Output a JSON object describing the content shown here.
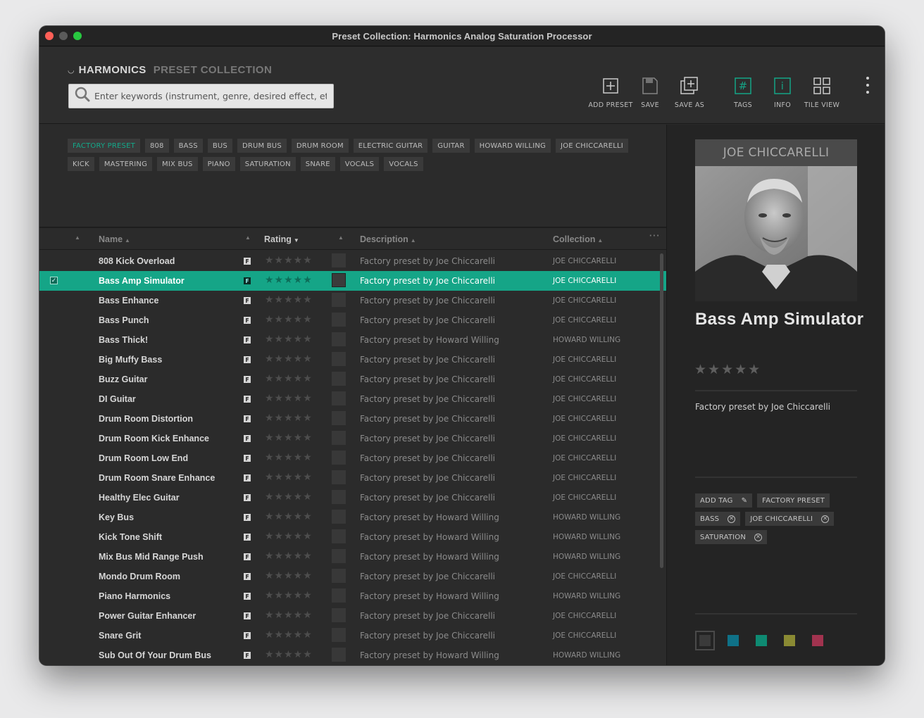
{
  "window": {
    "title": "Preset Collection: Harmonics Analog Saturation Processor"
  },
  "brand": {
    "name": "HARMONICS",
    "subtitle": "PRESET COLLECTION"
  },
  "search": {
    "placeholder": "Enter keywords (instrument, genre, desired effect, etc.)",
    "value": ""
  },
  "toolbar": {
    "add_preset": "ADD PRESET",
    "save": "SAVE",
    "save_as": "SAVE AS",
    "tags": "TAGS",
    "info": "INFO",
    "tile_view": "TILE VIEW"
  },
  "tag_filters": [
    {
      "label": "FACTORY PRESET",
      "active": true
    },
    {
      "label": "808"
    },
    {
      "label": "BASS"
    },
    {
      "label": "BUS"
    },
    {
      "label": "DRUM BUS"
    },
    {
      "label": "DRUM ROOM"
    },
    {
      "label": "ELECTRIC GUITAR"
    },
    {
      "label": "GUITAR"
    },
    {
      "label": "HOWARD WILLING"
    },
    {
      "label": "JOE CHICCARELLI"
    },
    {
      "label": "KICK"
    },
    {
      "label": "MASTERING"
    },
    {
      "label": "MIX BUS"
    },
    {
      "label": "PIANO"
    },
    {
      "label": "SATURATION"
    },
    {
      "label": "SNARE"
    },
    {
      "label": "VOCALS"
    },
    {
      "label": "VOCALS"
    }
  ],
  "table": {
    "columns": {
      "name": "Name",
      "rating": "Rating",
      "description": "Description",
      "collection": "Collection"
    },
    "rows": [
      {
        "name": "808 Kick Overload",
        "description": "Factory preset by Joe Chiccarelli",
        "collection": "JOE CHICCARELLI"
      },
      {
        "name": "Bass Amp Simulator",
        "description": "Factory preset by Joe Chiccarelli",
        "collection": "JOE CHICCARELLI",
        "selected": true
      },
      {
        "name": "Bass Enhance",
        "description": "Factory preset by Joe Chiccarelli",
        "collection": "JOE CHICCARELLI"
      },
      {
        "name": "Bass Punch",
        "description": "Factory preset by Joe Chiccarelli",
        "collection": "JOE CHICCARELLI"
      },
      {
        "name": "Bass Thick!",
        "description": "Factory preset by Howard Willing",
        "collection": "HOWARD WILLING"
      },
      {
        "name": "Big Muffy Bass",
        "description": "Factory preset by Joe Chiccarelli",
        "collection": "JOE CHICCARELLI"
      },
      {
        "name": "Buzz Guitar",
        "description": "Factory preset by Joe Chiccarelli",
        "collection": "JOE CHICCARELLI"
      },
      {
        "name": "DI Guitar",
        "description": "Factory preset by Joe Chiccarelli",
        "collection": "JOE CHICCARELLI"
      },
      {
        "name": "Drum Room Distortion",
        "description": "Factory preset by Joe Chiccarelli",
        "collection": "JOE CHICCARELLI"
      },
      {
        "name": "Drum Room Kick Enhance",
        "description": "Factory preset by Joe Chiccarelli",
        "collection": "JOE CHICCARELLI"
      },
      {
        "name": "Drum Room Low End",
        "description": "Factory preset by Joe Chiccarelli",
        "collection": "JOE CHICCARELLI"
      },
      {
        "name": "Drum Room Snare Enhance",
        "description": "Factory preset by Joe Chiccarelli",
        "collection": "JOE CHICCARELLI"
      },
      {
        "name": "Healthy Elec Guitar",
        "description": "Factory preset by Joe Chiccarelli",
        "collection": "JOE CHICCARELLI"
      },
      {
        "name": "Key Bus",
        "description": "Factory preset by Howard Willing",
        "collection": "HOWARD WILLING"
      },
      {
        "name": "Kick Tone Shift",
        "description": "Factory preset by Howard Willing",
        "collection": "HOWARD WILLING"
      },
      {
        "name": "Mix Bus Mid Range Push",
        "description": "Factory preset by Howard Willing",
        "collection": "HOWARD WILLING"
      },
      {
        "name": "Mondo Drum Room",
        "description": "Factory preset by Joe Chiccarelli",
        "collection": "JOE CHICCARELLI"
      },
      {
        "name": "Piano Harmonics",
        "description": "Factory preset by Howard Willing",
        "collection": "HOWARD WILLING"
      },
      {
        "name": "Power Guitar Enhancer",
        "description": "Factory preset by Joe Chiccarelli",
        "collection": "JOE CHICCARELLI"
      },
      {
        "name": "Snare Grit",
        "description": "Factory preset by Joe Chiccarelli",
        "collection": "JOE CHICCARELLI"
      },
      {
        "name": "Sub Out Of Your Drum Bus",
        "description": "Factory preset by Howard Willing",
        "collection": "HOWARD WILLING"
      }
    ],
    "factory_badge": "F",
    "stars": "★★★★★"
  },
  "detail": {
    "artist": "JOE CHICCARELLI",
    "title": "Bass Amp Simulator",
    "stars": "★★★★★",
    "description": "Factory preset by Joe Chiccarelli",
    "add_tag": "ADD TAG",
    "tags": [
      "FACTORY PRESET",
      "BASS",
      "JOE CHICCARELLI",
      "SATURATION"
    ],
    "swatches": [
      "#3a3a3a",
      "#0f7187",
      "#0e8a72",
      "#8a8a33",
      "#a1334f"
    ]
  },
  "colors": {
    "accent": "#15a587",
    "selected_row": "#15a587"
  }
}
